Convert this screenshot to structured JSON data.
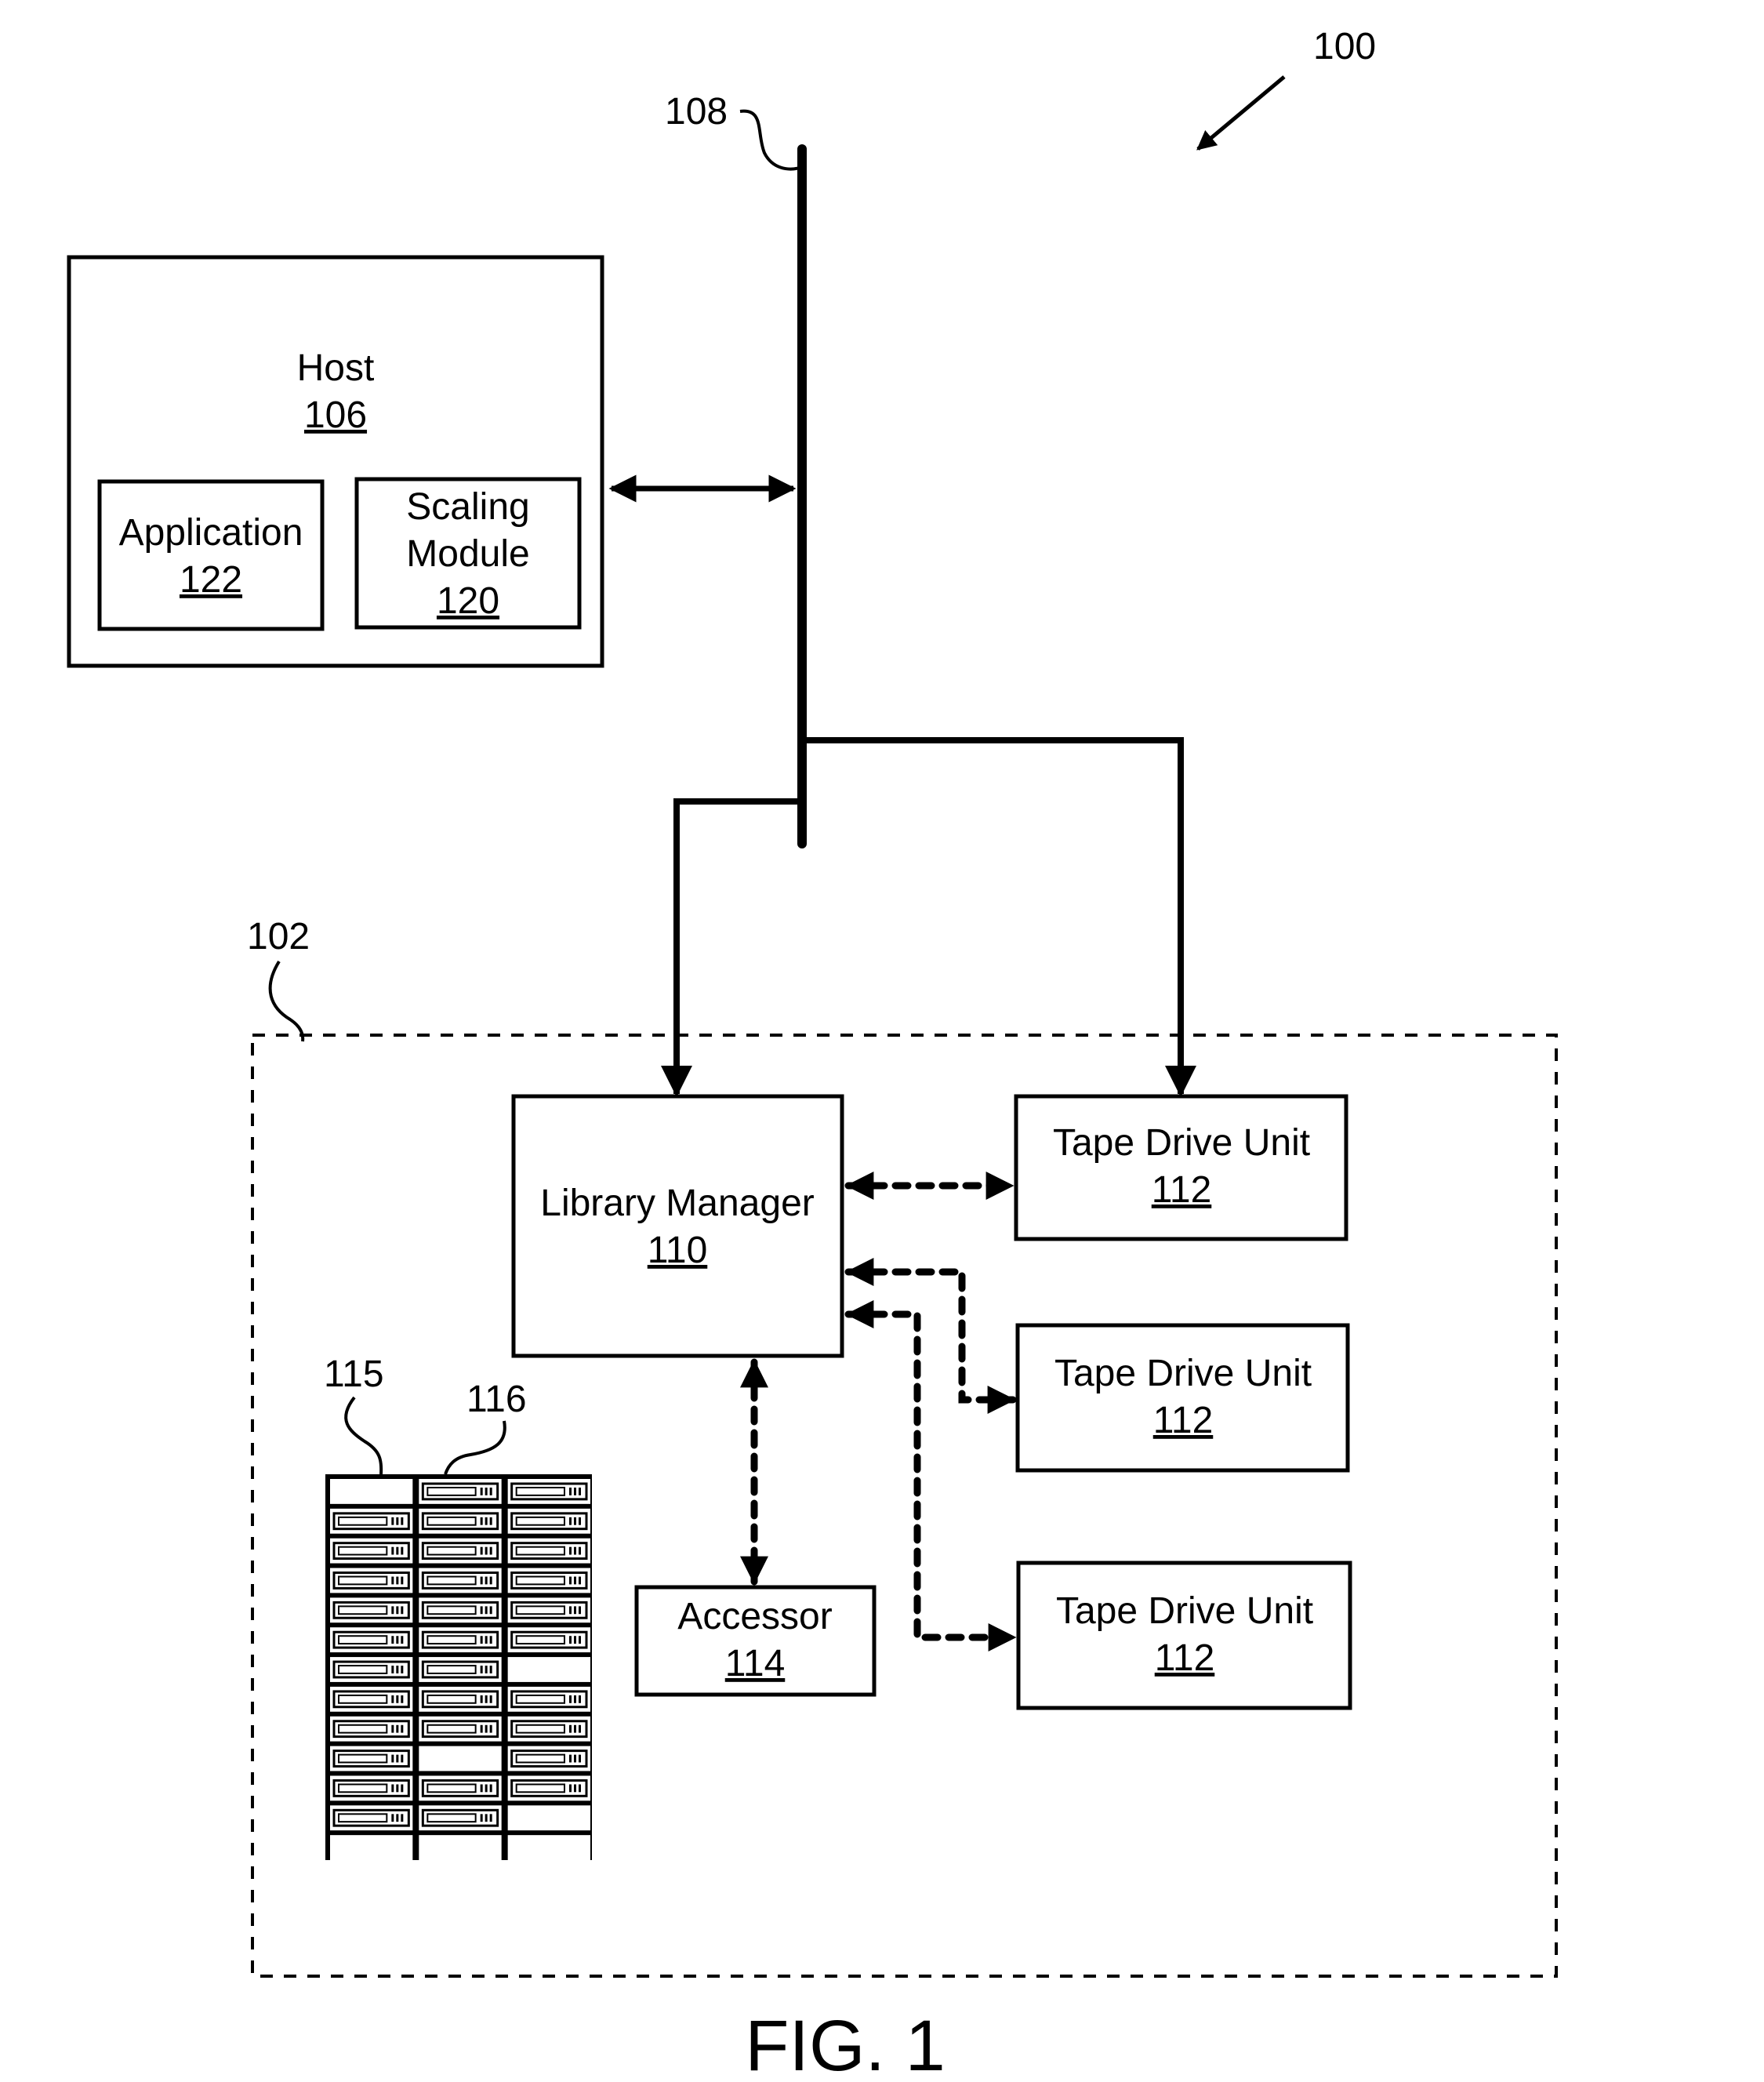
{
  "figure": {
    "caption": "FIG. 1",
    "system_ref": "100",
    "bus_ref": "108",
    "library_ref": "102",
    "rack_ref": "115",
    "slot_ref": "116"
  },
  "host": {
    "title": "Host",
    "ref": "106",
    "application": {
      "title": "Application",
      "ref": "122"
    },
    "scaling_module": {
      "title_line1": "Scaling",
      "title_line2": "Module",
      "ref": "120"
    }
  },
  "library": {
    "manager": {
      "title": "Library Manager",
      "ref": "110"
    },
    "accessor": {
      "title": "Accessor",
      "ref": "114"
    },
    "tape_drives": [
      {
        "title": "Tape Drive Unit",
        "ref": "112"
      },
      {
        "title": "Tape Drive Unit",
        "ref": "112"
      },
      {
        "title": "Tape Drive Unit",
        "ref": "112"
      }
    ],
    "rack_occupancy": [
      [
        0,
        1,
        1
      ],
      [
        1,
        1,
        1
      ],
      [
        1,
        1,
        1
      ],
      [
        1,
        1,
        1
      ],
      [
        1,
        1,
        1
      ],
      [
        1,
        1,
        1
      ],
      [
        1,
        1,
        0
      ],
      [
        1,
        1,
        1
      ],
      [
        1,
        1,
        1
      ],
      [
        1,
        0,
        1
      ],
      [
        1,
        1,
        1
      ],
      [
        1,
        1,
        0
      ],
      [
        0,
        0,
        0
      ]
    ]
  },
  "colors": {
    "ink": "#000000",
    "paper": "#ffffff"
  }
}
